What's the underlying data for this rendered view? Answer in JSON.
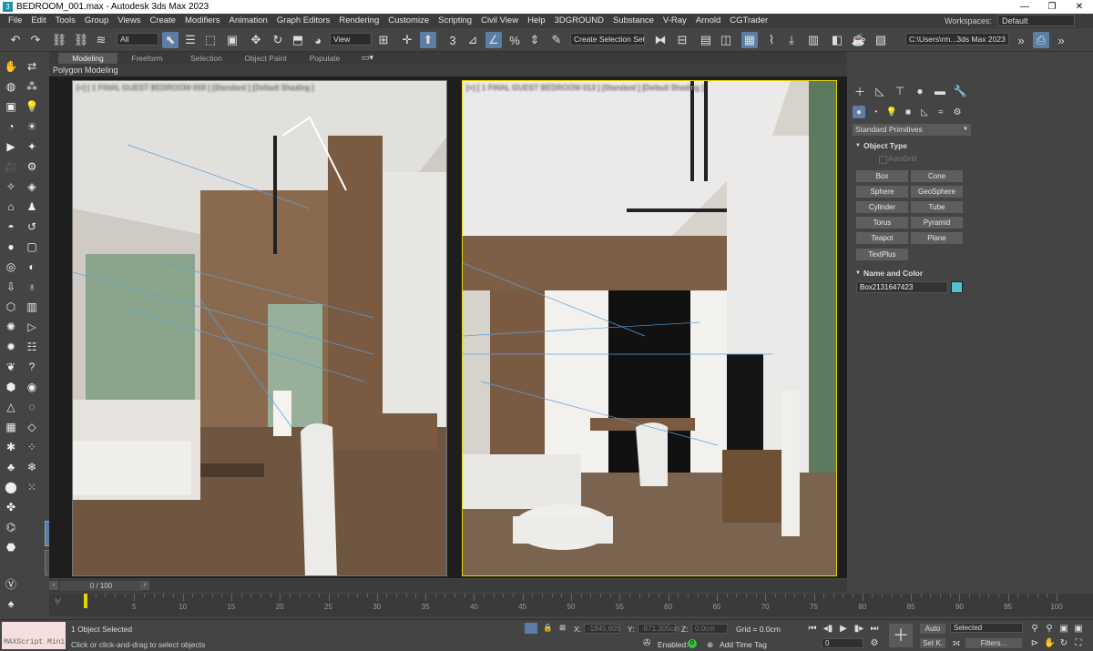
{
  "window": {
    "title": "BEDROOM_001.max - Autodesk 3ds Max 2023",
    "app_icon": "3ds-max-icon",
    "minimize": "—",
    "maximize": "❐",
    "close": "✕"
  },
  "menu": [
    "File",
    "Edit",
    "Tools",
    "Group",
    "Views",
    "Create",
    "Modifiers",
    "Animation",
    "Graph Editors",
    "Rendering",
    "Customize",
    "Scripting",
    "Civil View",
    "Help",
    "3DGROUND",
    "Substance",
    "V-Ray",
    "Arnold",
    "CGTrader"
  ],
  "workspaces": {
    "label": "Workspaces:",
    "value": "Default"
  },
  "toolbar": {
    "filter_value": "All",
    "view_value": "View",
    "selection_set_placeholder": "Create Selection Set",
    "path_value": "C:\\Users\\rm...3ds Max 2023"
  },
  "ribbon": {
    "tabs": [
      "Modeling",
      "Freeform",
      "Selection",
      "Object Paint",
      "Populate"
    ],
    "active_tab": "Modeling",
    "subtitle": "Polygon Modeling"
  },
  "viewports": {
    "left_label": "[+] [ 1 FINAL GUEST BEDROOM 009 ] [Standard ] [Default Shading ]",
    "right_label": "[+] [ 1 FINAL GUEST BEDROOM 013 ] [Standard ] [Default Shading ]"
  },
  "command_panel": {
    "category": "Standard Primitives",
    "object_type_title": "Object Type",
    "autogrid": "AutoGrid",
    "buttons": [
      "Box",
      "Cone",
      "Sphere",
      "GeoSphere",
      "Cylinder",
      "Tube",
      "Torus",
      "Pyramid",
      "Teapot",
      "Plane",
      "TextPlus"
    ],
    "name_color_title": "Name and Color",
    "object_name": "Box2131647423",
    "object_color": "#52c4cf"
  },
  "timeline": {
    "frame_display": "0 / 100",
    "ticks": [
      0,
      5,
      10,
      15,
      20,
      25,
      30,
      35,
      40,
      45,
      50,
      55,
      60,
      65,
      70,
      75,
      80,
      85,
      90,
      95,
      100
    ],
    "current_frame": 0,
    "total_frames": 100
  },
  "status": {
    "maxscript_label": "MAXScript Mini",
    "selection_text": "1 Object Selected",
    "prompt_text": "Click or click-and-drag to select objects",
    "x_label": "X:",
    "x_value": "-1845.605",
    "y_label": "Y:",
    "y_value": "-871.305cm",
    "z_label": "Z:",
    "z_value": "0.0cm",
    "grid_text": "Grid = 0.0cm",
    "enabled_label": "Enabled:",
    "enabled_value": "0",
    "add_time_tag": "Add Time Tag",
    "auto_label": "Auto",
    "selected_value": "Selected",
    "setk_label": "Set K.",
    "filters_label": "Filters...",
    "frame_value": "0"
  },
  "colors": {
    "accent": "#5b7ea4",
    "active_viewport_border": "#e4d400",
    "ui_bg": "#444444"
  }
}
